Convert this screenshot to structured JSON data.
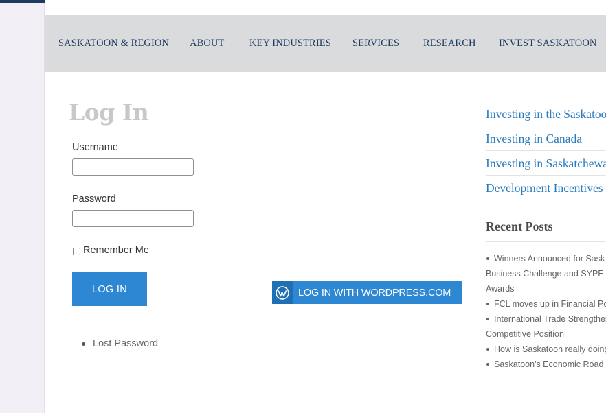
{
  "nav": {
    "items": [
      "SASKATOON & REGION",
      "ABOUT",
      "KEY INDUSTRIES",
      "SERVICES",
      "RESEARCH",
      "INVEST SASKATOON"
    ]
  },
  "login": {
    "title": "Log In",
    "username_label": "Username",
    "username_value": "",
    "password_label": "Password",
    "password_value": "",
    "remember_label": "Remember Me",
    "remember_checked": false,
    "submit_label": "LOG IN",
    "wp_button_label": "LOG IN WITH WORDPRESS.COM",
    "lost_password": "Lost Password"
  },
  "sidebar": {
    "links": [
      "Investing in the Saskatoon",
      "Investing in Canada",
      "Investing in Saskatchewan",
      "Development Incentives"
    ],
    "recent_title": "Recent Posts",
    "posts": [
      {
        "line1": "Winners Announced for Sask",
        "line2": "Business Challenge and SYPE S",
        "line3": "Awards"
      },
      {
        "line1": "FCL moves up in Financial Po"
      },
      {
        "line1": "International Trade Strengthen",
        "line2": "Competitive Position"
      },
      {
        "line1": "How is Saskatoon really doing"
      },
      {
        "line1": "Saskatoon's Economic Road"
      }
    ]
  },
  "colors": {
    "nav_bg": "#d9dbdd",
    "nav_text": "#1f3a5f",
    "button_blue": "#2d87d2",
    "link_blue": "#2a7cc0",
    "title_gray": "#c8c8c8"
  },
  "icons": {
    "wordpress": "wordpress-logo-icon",
    "checkbox": "checkbox-icon"
  }
}
